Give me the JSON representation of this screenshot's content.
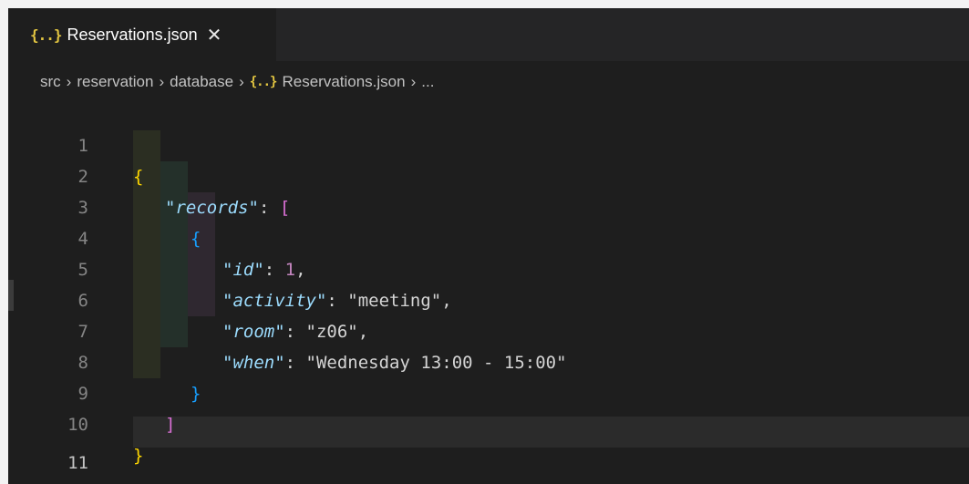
{
  "tab": {
    "label": "Reservations.json",
    "icon": "{..}",
    "close_glyph": "✕"
  },
  "breadcrumb": {
    "items": [
      "src",
      "reservation",
      "database"
    ],
    "file_icon": "{..}",
    "file": "Reservations.json",
    "ellipsis": "...",
    "separator": "›"
  },
  "editor": {
    "line_numbers": [
      "1",
      "2",
      "3",
      "4",
      "5",
      "6",
      "7",
      "8",
      "9",
      "10",
      "11"
    ],
    "active_line": "11",
    "code": {
      "open_brace": "{",
      "records_key": "\"records\"",
      "colon": ":",
      "open_bracket": "[",
      "obj_open": "{",
      "id_key": "\"id\"",
      "id_value": "1",
      "activity_key": "\"activity\"",
      "activity_value": "\"meeting\"",
      "room_key": "\"room\"",
      "room_value": "\"z06\"",
      "when_key": "\"when\"",
      "when_value": "\"Wednesday 13:00 - 15:00\"",
      "comma": ",",
      "obj_close": "}",
      "close_bracket": "]",
      "close_brace": "}"
    }
  },
  "colors": {
    "editor_bg": "#1e1e1e",
    "key": "#9cdcfe",
    "bracket_level1": "#ffd700",
    "bracket_level2": "#da70d6",
    "bracket_level3": "#179fff"
  }
}
